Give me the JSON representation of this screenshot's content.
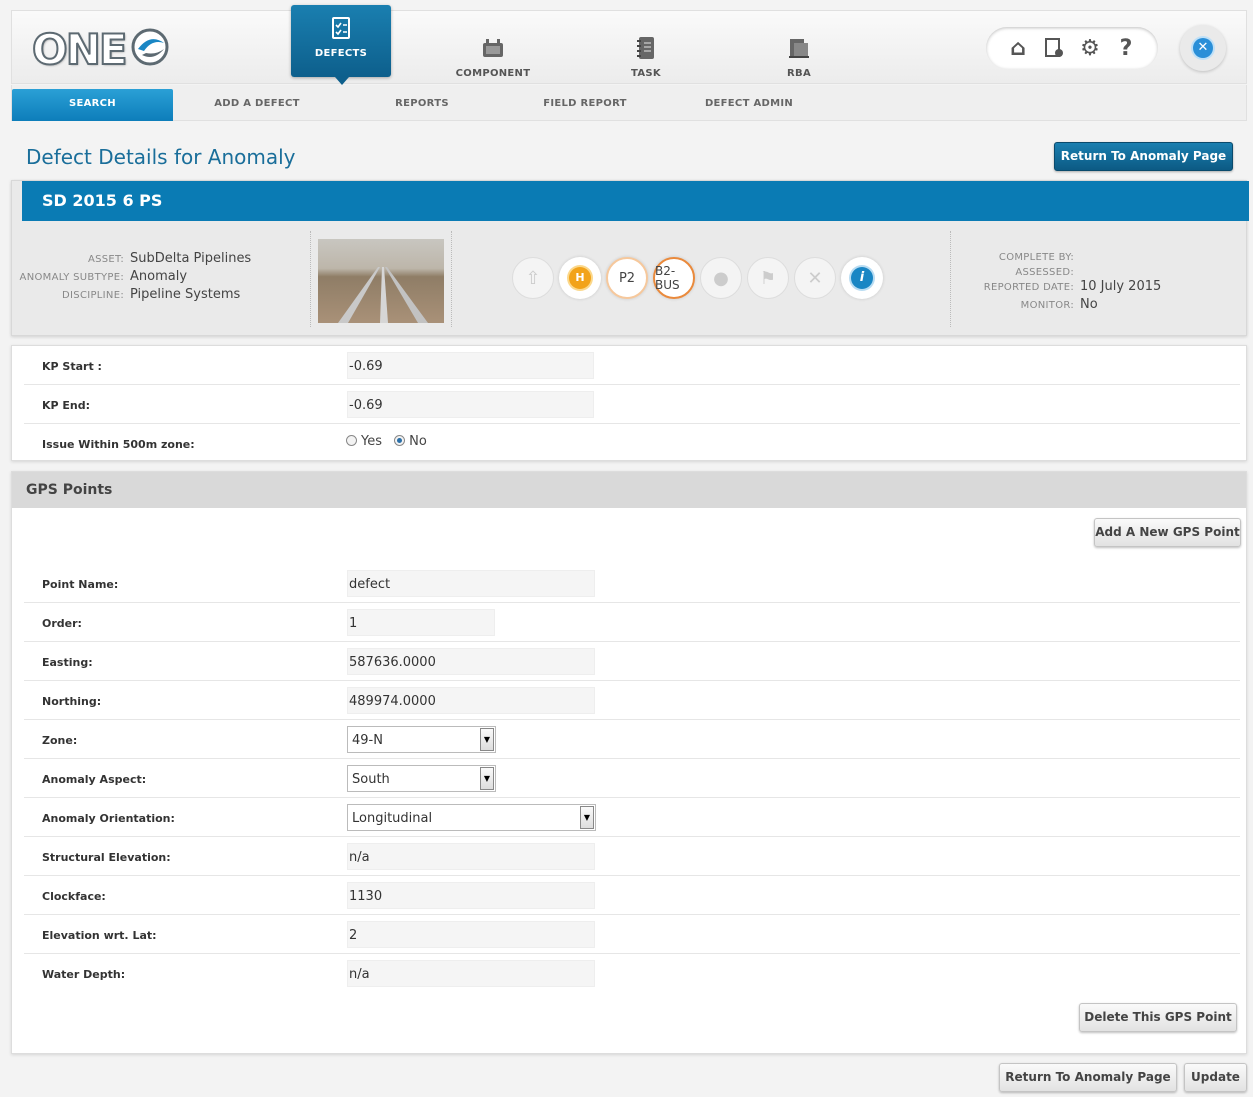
{
  "app": {
    "logo_text": "ONE",
    "main_nav": [
      {
        "label": "DEFECTS",
        "icon": "clipboard-checklist-icon"
      },
      {
        "label": "COMPONENT",
        "icon": "component-icon"
      },
      {
        "label": "TASK",
        "icon": "notebook-icon"
      },
      {
        "label": "RBA",
        "icon": "document-stack-icon"
      }
    ],
    "utility_icons": [
      "home-icon",
      "document-settings-icon",
      "gears-icon",
      "help-icon"
    ],
    "close_glyph": "✕"
  },
  "sub_nav": [
    "SEARCH",
    "ADD A DEFECT",
    "REPORTS",
    "FIELD REPORT",
    "DEFECT ADMIN"
  ],
  "page": {
    "title": "Defect Details for Anomaly",
    "return_button": "Return To Anomaly Page"
  },
  "anomaly": {
    "id": "SD 2015 6 PS",
    "left_meta": [
      {
        "key": "ASSET:",
        "value": "SubDelta Pipelines"
      },
      {
        "key": "ANOMALY SUBTYPE:",
        "value": "Anomaly"
      },
      {
        "key": "DISCIPLINE:",
        "value": "Pipeline Systems"
      }
    ],
    "status_icons": [
      {
        "name": "upload-icon",
        "glyph": "⇧",
        "active": false
      },
      {
        "name": "h-badge-icon",
        "glyph": "H",
        "active": true
      },
      {
        "name": "p2-priority-icon",
        "glyph": "P2",
        "active": true
      },
      {
        "name": "b2-bus-icon",
        "glyph": "B2-BUS",
        "active": true
      },
      {
        "name": "droplet-icon",
        "glyph": "●",
        "active": false
      },
      {
        "name": "flag-icon",
        "glyph": "⚑",
        "active": false
      },
      {
        "name": "tools-icon",
        "glyph": "✕",
        "active": false
      },
      {
        "name": "info-icon",
        "glyph": "i",
        "active": true
      }
    ],
    "right_meta": [
      {
        "key": "COMPLETE BY:",
        "value": ""
      },
      {
        "key": "ASSESSED:",
        "value": ""
      },
      {
        "key": "REPORTED DATE:",
        "value": "10 July 2015"
      },
      {
        "key": "MONITOR:",
        "value": "No"
      }
    ]
  },
  "kp": {
    "start_label": "KP Start :",
    "start_value": "-0.69",
    "end_label": "KP End:",
    "end_value": "-0.69",
    "zone_label": "Issue Within 500m zone:",
    "zone_yes": "Yes",
    "zone_no": "No",
    "zone_selected": "No"
  },
  "gps": {
    "title": "GPS Points",
    "add_button": "Add A New GPS Point",
    "delete_button": "Delete This GPS Point",
    "fields": [
      {
        "label": "Point Name:",
        "value": "defect",
        "kind": "input"
      },
      {
        "label": "Order:",
        "value": "1",
        "kind": "input"
      },
      {
        "label": "Easting:",
        "value": "587636.0000",
        "kind": "input"
      },
      {
        "label": "Northing:",
        "value": "489974.0000",
        "kind": "input"
      },
      {
        "label": "Zone:",
        "value": "49-N",
        "kind": "select"
      },
      {
        "label": "Anomaly Aspect:",
        "value": "South",
        "kind": "select"
      },
      {
        "label": "Anomaly Orientation:",
        "value": "Longitudinal",
        "kind": "select"
      },
      {
        "label": "Structural Elevation:",
        "value": "n/a",
        "kind": "input"
      },
      {
        "label": "Clockface:",
        "value": "1130",
        "kind": "input"
      },
      {
        "label": "Elevation wrt. Lat:",
        "value": "2",
        "kind": "input"
      },
      {
        "label": "Water Depth:",
        "value": "n/a",
        "kind": "input"
      }
    ]
  },
  "footer": {
    "return_button": "Return To Anomaly Page",
    "update_button": "Update"
  }
}
